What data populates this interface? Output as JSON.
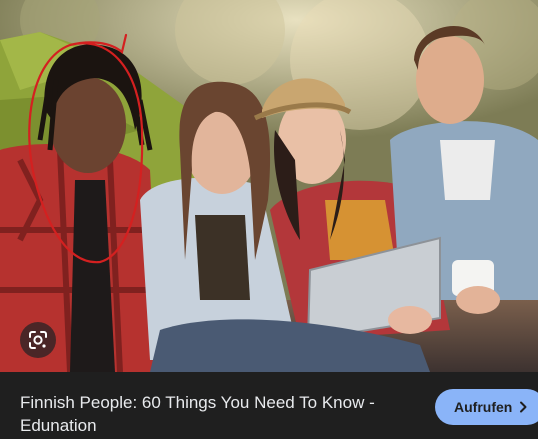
{
  "image": {
    "lens_icon": "google-lens-icon",
    "annotation_color": "#d42020"
  },
  "result": {
    "title": "Finnish People: 60 Things You Need To Know - Edunation",
    "visit_label": "Aufrufen",
    "visit_icon": "chevron-right-icon",
    "accent_color": "#8ab4f8"
  }
}
